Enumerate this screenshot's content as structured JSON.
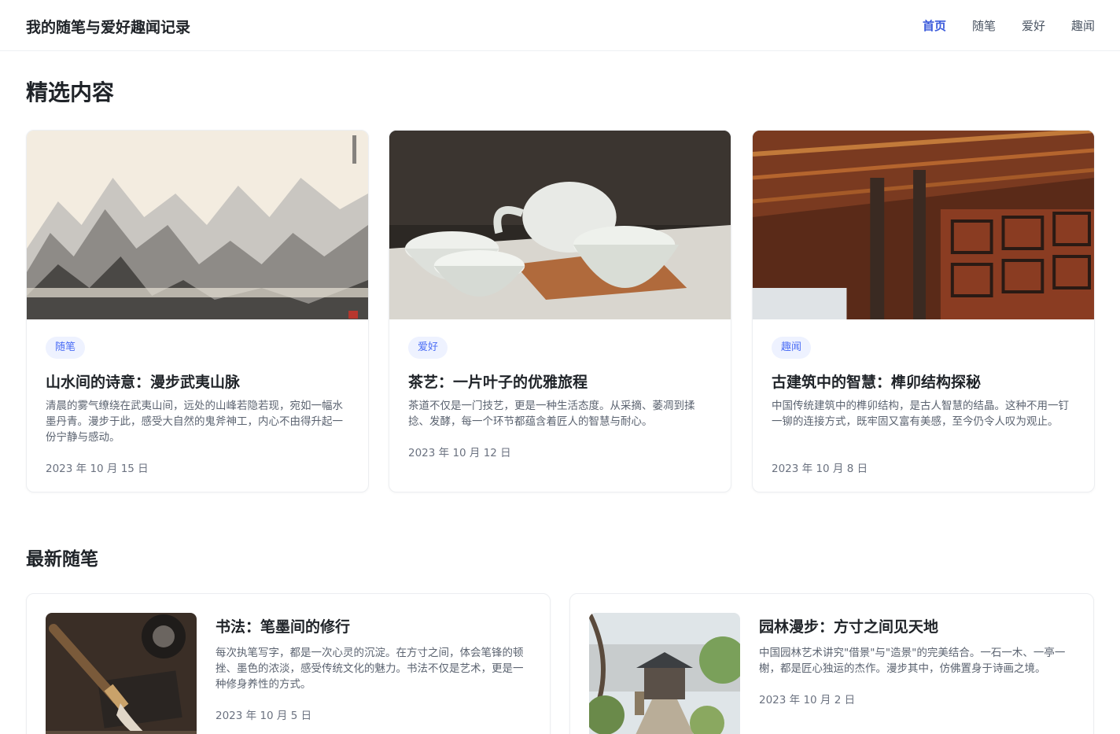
{
  "header": {
    "site_title": "我的随笔与爱好趣闻记录",
    "nav": [
      {
        "label": "首页",
        "active": true
      },
      {
        "label": "随笔",
        "active": false
      },
      {
        "label": "爱好",
        "active": false
      },
      {
        "label": "趣闻",
        "active": false
      }
    ]
  },
  "featured": {
    "title": "精选内容",
    "cards": [
      {
        "image": "ink-landscape-painting",
        "category": "随笔",
        "title": "山水间的诗意：漫步武夷山脉",
        "excerpt": "清晨的雾气缭绕在武夷山间，远处的山峰若隐若现，宛如一幅水墨丹青。漫步于此，感受大自然的鬼斧神工，内心不由得升起一份宁静与感动。",
        "date": "2023 年 10 月 15 日"
      },
      {
        "image": "tea-cups-teapot",
        "category": "爱好",
        "title": "茶艺：一片叶子的优雅旅程",
        "excerpt": "茶道不仅是一门技艺，更是一种生活态度。从采摘、萎凋到揉捻、发酵，每一个环节都蕴含着匠人的智慧与耐心。",
        "date": "2023 年 10 月 12 日"
      },
      {
        "image": "ancient-wooden-architecture",
        "category": "趣闻",
        "title": "古建筑中的智慧：榫卯结构探秘",
        "excerpt": "中国传统建筑中的榫卯结构，是古人智慧的结晶。这种不用一钉一铆的连接方式，既牢固又富有美感，至今仍令人叹为观止。",
        "date": "2023 年 10 月 8 日"
      }
    ]
  },
  "latest": {
    "title": "最新随笔",
    "cards": [
      {
        "image": "calligraphy-brush",
        "title": "书法：笔墨间的修行",
        "excerpt": "每次执笔写字，都是一次心灵的沉淀。在方寸之间，体会笔锋的顿挫、墨色的浓淡，感受传统文化的魅力。书法不仅是艺术，更是一种修身养性的方式。",
        "date": "2023 年 10 月 5 日"
      },
      {
        "image": "chinese-garden-path",
        "title": "园林漫步：方寸之间见天地",
        "excerpt": "中国园林艺术讲究\"借景\"与\"造景\"的完美结合。一石一木、一亭一榭，都是匠心独运的杰作。漫步其中，仿佛置身于诗画之境。",
        "date": "2023 年 10 月 2 日"
      }
    ]
  },
  "colors": {
    "accent": "#3b5bdb",
    "badge_bg": "#eef2ff",
    "badge_text": "#4c6ef5"
  }
}
